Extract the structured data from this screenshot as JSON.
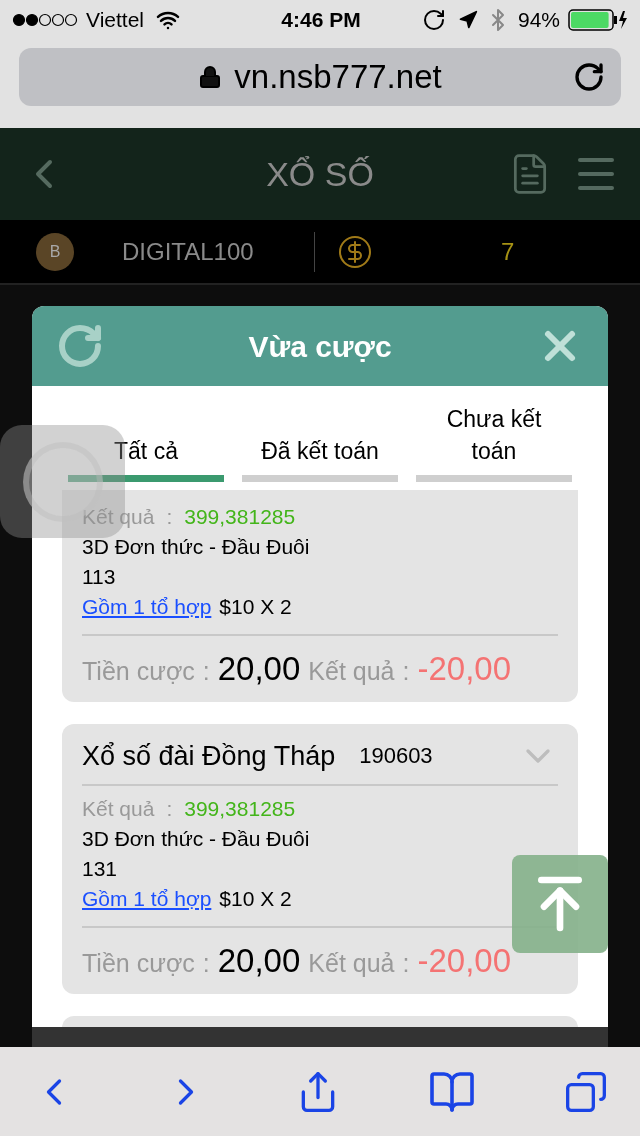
{
  "status_bar": {
    "carrier": "Viettel",
    "time": "4:46 PM",
    "battery": "94%"
  },
  "address_bar": {
    "url": "vn.nsb777.net"
  },
  "header": {
    "title": "XỔ SỐ"
  },
  "account": {
    "avatar_letter": "B",
    "username": "DIGITAL100",
    "balance": "7"
  },
  "modal": {
    "title": "Vừa cược",
    "tabs": [
      {
        "label": "Tất cả",
        "selected": true
      },
      {
        "label": "Đã kết toán",
        "selected": false
      },
      {
        "label": "Chưa kết toán",
        "selected": false
      }
    ],
    "bets": [
      {
        "result_label": "Kết quả",
        "result_sep": ":",
        "result_value": "399,381285",
        "bet_type": "3D Đơn thức - Đầu Đuôi",
        "numbers": "113",
        "combo_link": "Gồm 1 tổ hợp",
        "combo_amount": "$10 X 2",
        "stake_label": "Tiền cược",
        "stake_sep": ":",
        "stake": "20,00",
        "outcome_label": "Kết quả",
        "outcome_sep": ":",
        "outcome": "-20,00"
      },
      {
        "title": "Xổ số đài Đồng Tháp",
        "code": "190603",
        "result_label": "Kết quả",
        "result_sep": ":",
        "result_value": "399,381285",
        "bet_type": "3D Đơn thức - Đầu Đuôi",
        "numbers": "131",
        "combo_link": "Gồm 1 tổ hợp",
        "combo_amount": "$10 X 2",
        "stake_label": "Tiền cược",
        "stake_sep": ":",
        "stake": "20,00",
        "outcome_label": "Kết quả",
        "outcome_sep": ":",
        "outcome": "-20,00"
      }
    ],
    "more_below": true
  }
}
